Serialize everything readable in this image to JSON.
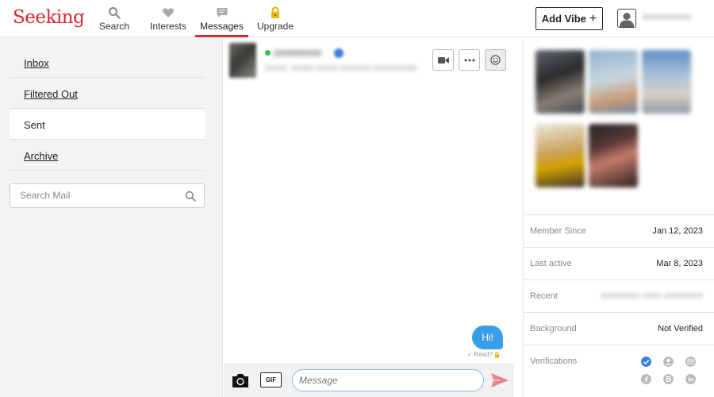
{
  "brand": {
    "logo_text": "Seeking",
    "accent_color": "#d7272f"
  },
  "nav": {
    "items": [
      {
        "label": "Search",
        "icon": "magnifier-icon"
      },
      {
        "label": "Interests",
        "icon": "heart-icon"
      },
      {
        "label": "Messages",
        "icon": "chat-bubble-icon",
        "active": true
      },
      {
        "label": "Upgrade",
        "icon": "lock-icon"
      }
    ]
  },
  "header": {
    "add_vibe_label": "Add Vibe",
    "add_vibe_icon": "plus-icon",
    "username": "##########"
  },
  "mail": {
    "folders": [
      {
        "label": "Inbox"
      },
      {
        "label": "Filtered Out"
      },
      {
        "label": "Sent",
        "active": true
      },
      {
        "label": "Archive"
      }
    ],
    "search_placeholder": "Search Mail"
  },
  "chat": {
    "contact_name": "#########",
    "contact_meta": "#####, ##### ##### ####### ##########",
    "online_color": "#3cc24b",
    "header_buttons": [
      "video-camera-icon",
      "more-dots-icon",
      "smiley-icon"
    ],
    "messages": [
      {
        "text": "Hi!",
        "direction": "outgoing",
        "status": "Read?"
      }
    ],
    "bubble_color": "#3a9de8",
    "composer": {
      "gif_label": "GIF",
      "placeholder": "Message",
      "camera_icon": "camera-icon",
      "send_icon": "send-arrow-icon"
    }
  },
  "profile": {
    "info": [
      {
        "label": "Member Since",
        "value": "Jan 12, 2023"
      },
      {
        "label": "Last active",
        "value": "Mar 8, 2023"
      },
      {
        "label": "Recent",
        "value": "######## #### ########"
      },
      {
        "label": "Background",
        "value": "Not Verified"
      },
      {
        "label": "Verifications",
        "value": ""
      }
    ],
    "verification_icons": [
      "check-circle-icon",
      "user-circle-icon",
      "id-card-icon",
      "facebook-icon",
      "instagram-icon",
      "linkedin-icon"
    ]
  }
}
